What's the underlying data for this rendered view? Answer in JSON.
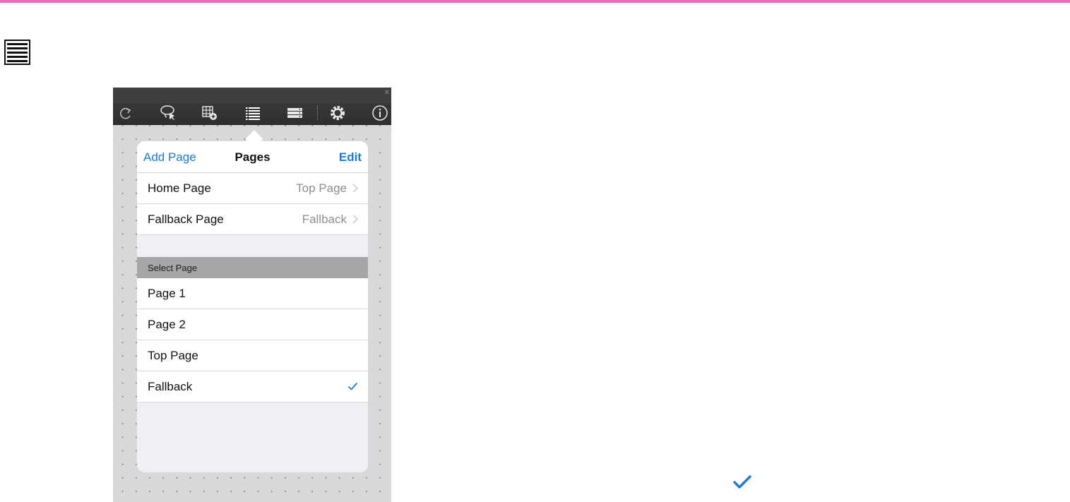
{
  "colors": {
    "top_bar": "#e86bbd",
    "accent": "#1a7be0",
    "toolbar_bg": "#3a3a3a",
    "section_header_bg": "#a6a6a6"
  },
  "toolbar": {
    "icons": [
      "redo-icon",
      "lasso-select-icon",
      "add-table-icon",
      "pages-list-icon",
      "database-icon",
      "gear-icon",
      "info-icon"
    ]
  },
  "popover": {
    "add_page_label": "Add Page",
    "title": "Pages",
    "edit_label": "Edit",
    "settings": [
      {
        "label": "Home Page",
        "value": "Top Page"
      },
      {
        "label": "Fallback Page",
        "value": "Fallback"
      }
    ],
    "section_header": "Select Page",
    "pages": [
      {
        "label": "Page 1",
        "selected": false
      },
      {
        "label": "Page 2",
        "selected": false
      },
      {
        "label": "Top Page",
        "selected": false
      },
      {
        "label": "Fallback",
        "selected": true
      }
    ]
  }
}
